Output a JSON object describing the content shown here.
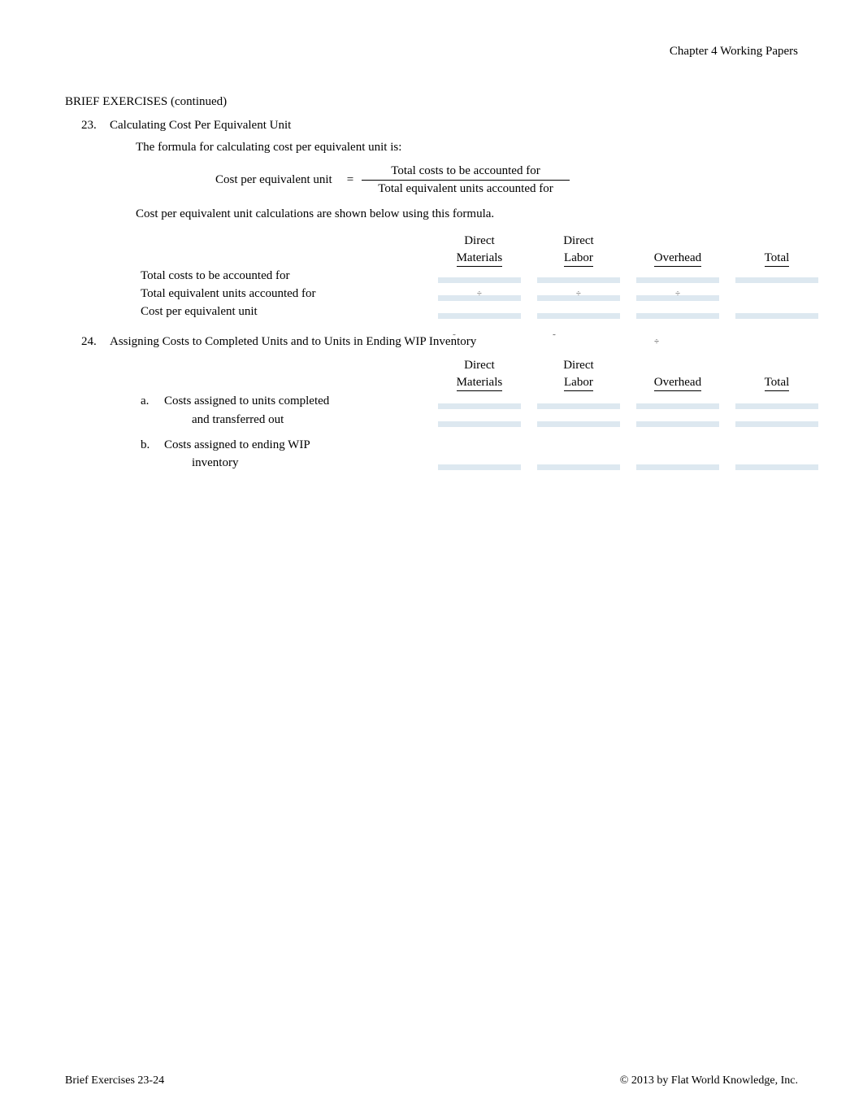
{
  "header": {
    "chapter": "Chapter 4 Working Papers"
  },
  "section": {
    "title": "BRIEF EXERCISES   (continued)"
  },
  "ex23": {
    "num": "23.",
    "title": "Calculating Cost Per Equivalent Unit",
    "intro": "The formula for calculating cost per equivalent unit is:",
    "formula_left": "Cost per equivalent unit",
    "formula_eq": "=",
    "formula_num": "Total costs to be accounted for",
    "formula_den": "Total equivalent units accounted for",
    "sub_intro": "Cost per equivalent unit calculations are shown below using this formula.",
    "cols": {
      "dm1": "Direct",
      "dm2": "Materials",
      "dl1": "Direct",
      "dl2": "Labor",
      "oh": "Overhead",
      "tot": "Total"
    },
    "rows": {
      "r1": "Total costs to be accounted for",
      "r2": "Total equivalent units accounted for",
      "r3": "Cost per equivalent unit"
    },
    "divide": "÷"
  },
  "ex24": {
    "num": "24.",
    "title": "Assigning Costs to Completed Units and to Units in Ending WIP Inventory",
    "cols": {
      "dm1": "Direct",
      "dm2": "Materials",
      "dl1": "Direct",
      "dl2": "Labor",
      "oh": "Overhead",
      "tot": "Total"
    },
    "a": "a.",
    "a_text1": "Costs assigned to units completed",
    "a_text2": "and transferred out",
    "b": "b.",
    "b_text1": "Costs assigned to ending WIP",
    "b_text2": "inventory",
    "divide": "÷",
    "tilde": "˜"
  },
  "footer": {
    "left": "Brief Exercises 23-24",
    "right": "© 2013 by Flat World Knowledge, Inc."
  }
}
